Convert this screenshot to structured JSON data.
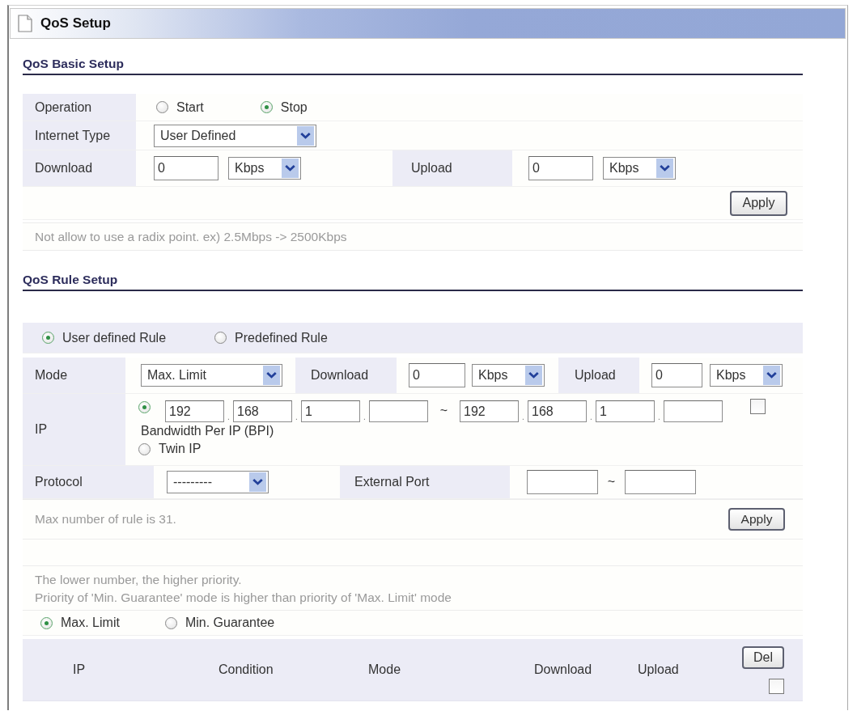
{
  "page": {
    "title": "QoS Setup"
  },
  "basic_setup": {
    "heading": "QoS Basic Setup",
    "operation": {
      "label": "Operation",
      "options": [
        {
          "label": "Start",
          "selected": false
        },
        {
          "label": "Stop",
          "selected": true
        }
      ]
    },
    "internet_type": {
      "label": "Internet Type",
      "value": "User Defined"
    },
    "download": {
      "label": "Download",
      "value": "0",
      "unit": "Kbps"
    },
    "upload": {
      "label": "Upload",
      "value": "0",
      "unit": "Kbps"
    },
    "apply_button": "Apply",
    "note": "Not allow to use a radix point. ex) 2.5Mbps -> 2500Kbps"
  },
  "rule_setup": {
    "heading": "QoS Rule Setup",
    "rule_types": [
      {
        "label": "User defined Rule",
        "selected": true
      },
      {
        "label": "Predefined Rule",
        "selected": false
      }
    ],
    "mode": {
      "label": "Mode",
      "value": "Max. Limit"
    },
    "download": {
      "label": "Download",
      "value": "0",
      "unit": "Kbps"
    },
    "upload": {
      "label": "Upload",
      "value": "0",
      "unit": "Kbps"
    },
    "ip": {
      "label": "IP",
      "range_start": [
        "192",
        "168",
        "1"
      ],
      "octet_separator": ".",
      "range_separator": "~",
      "range_end": [
        "192",
        "168",
        "1"
      ],
      "checked": false,
      "options": [
        {
          "label": "Bandwidth Per IP (BPI)",
          "selected": true
        },
        {
          "label": "Twin IP",
          "selected": false
        }
      ]
    },
    "protocol": {
      "label": "Protocol",
      "value": "---------"
    },
    "external_port": {
      "label": "External Port",
      "separator": "~"
    },
    "apply_button": "Apply",
    "note": "Max number of rule is 31."
  },
  "priority": {
    "notes": [
      "The lower number, the higher priority.",
      "Priority of 'Min. Guarantee' mode is higher than priority of 'Max. Limit' mode"
    ],
    "modes": [
      {
        "label": "Max. Limit",
        "selected": true
      },
      {
        "label": "Min. Guarantee",
        "selected": false
      }
    ],
    "table": {
      "columns": [
        "IP",
        "Condition",
        "Mode",
        "Download",
        "Upload"
      ],
      "delete_button": "Del",
      "select_all_checked": false
    }
  }
}
